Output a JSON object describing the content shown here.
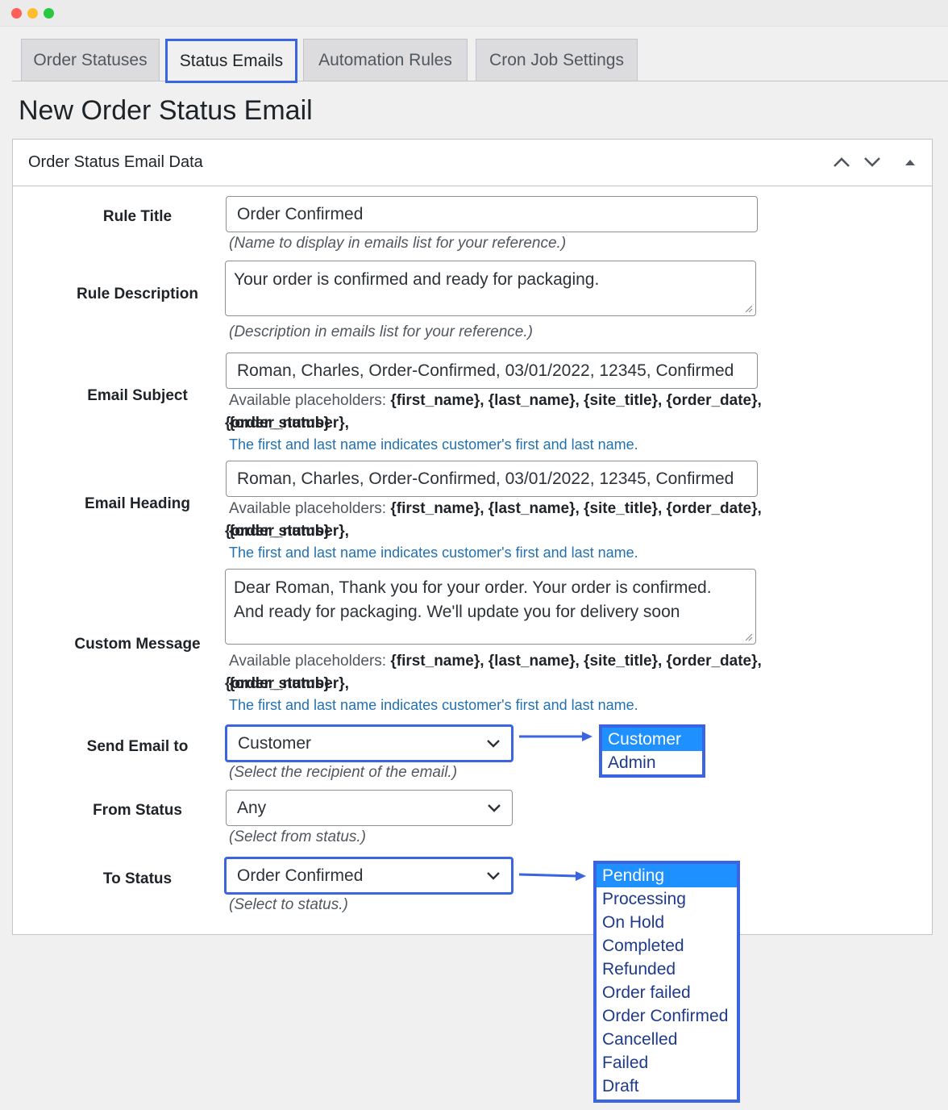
{
  "window": {
    "dots": [
      "#ff5f57",
      "#febc2e",
      "#28c840"
    ]
  },
  "tabs": [
    {
      "label": "Order Statuses"
    },
    {
      "label": "Status Emails"
    },
    {
      "label": "Automation Rules"
    },
    {
      "label": "Cron Job Settings"
    }
  ],
  "page_title": "New Order Status Email",
  "panel": {
    "title": "Order Status Email Data",
    "controls": [
      "chevron-up-icon",
      "chevron-down-icon",
      "triangle-up-icon"
    ]
  },
  "fields": {
    "rule_title": {
      "label": "Rule Title",
      "value": "Order Confirmed",
      "hint": "(Name to display in emails list for your reference.)"
    },
    "rule_description": {
      "label": "Rule Description",
      "value": "Your order is confirmed and ready for packaging.",
      "hint": "(Description in emails list for your reference.)"
    },
    "email_subject": {
      "label": "Email Subject",
      "value": "Roman, Charles, Order-Confirmed, 03/01/2022, 12345, Confirmed"
    },
    "email_heading": {
      "label": "Email Heading",
      "value": "Roman, Charles, Order-Confirmed, 03/01/2022, 12345, Confirmed"
    },
    "custom_message": {
      "label": "Custom Message",
      "value": "Dear Roman, Thank you for your order. Your order is confirmed. And ready for packaging. We'll update you for delivery soon"
    },
    "send_email_to": {
      "label": "Send Email to",
      "value": "Customer",
      "hint": "(Select the recipient of the email.)"
    },
    "from_status": {
      "label": "From Status",
      "value": "Any",
      "hint": "(Select from status.)"
    },
    "to_status": {
      "label": "To Status",
      "value": "Order Confirmed",
      "hint": "(Select to status.)"
    }
  },
  "placeholders": {
    "prefix": "Available placeholders:",
    "line1": "{first_name}, {last_name}, {site_title}, {order_date}, {order_number},",
    "line2": "{order_status}",
    "note": "The first and last name indicates customer's first and last name."
  },
  "recipient_options": [
    "Customer",
    "Admin"
  ],
  "status_options": [
    "Pending",
    "Processing",
    "On Hold",
    "Completed",
    "Refunded",
    "Order failed",
    "Order Confirmed",
    "Cancelled",
    "Failed",
    "Draft"
  ],
  "colors": {
    "accent": "#3b64e0",
    "selected_option": "#1e90ff",
    "link": "#2271b1"
  }
}
